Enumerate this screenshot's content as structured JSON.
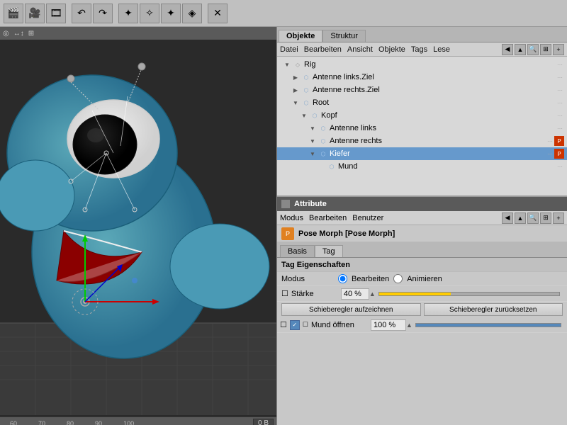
{
  "toolbar": {
    "icons": [
      "■",
      "▶",
      "⬛",
      "↶",
      "↷",
      "✦",
      "✧",
      "✦",
      "◈",
      "✕"
    ]
  },
  "viewport": {
    "top_bar_items": [
      "◎",
      "↔↕",
      "⊞"
    ],
    "ruler_marks": [
      "60",
      "70",
      "80",
      "90",
      "100"
    ],
    "ruler_info": "0 B"
  },
  "object_panel": {
    "tabs": [
      "Objekte",
      "Struktur"
    ],
    "menubar_items": [
      "Datei",
      "Bearbeiten",
      "Ansicht",
      "Objekte",
      "Tags",
      "Lese"
    ],
    "tree_items": [
      {
        "label": "Rig",
        "depth": 1,
        "expanded": true,
        "has_tag": false
      },
      {
        "label": "Antenne links.Ziel",
        "depth": 2,
        "expanded": false,
        "has_tag": false
      },
      {
        "label": "Antenne rechts.Ziel",
        "depth": 2,
        "expanded": false,
        "has_tag": false
      },
      {
        "label": "Root",
        "depth": 2,
        "expanded": true,
        "has_tag": false
      },
      {
        "label": "Kopf",
        "depth": 3,
        "expanded": true,
        "has_tag": false
      },
      {
        "label": "Antenne links",
        "depth": 4,
        "expanded": true,
        "has_tag": false
      },
      {
        "label": "Antenne rechts",
        "depth": 4,
        "expanded": true,
        "has_tag": true
      },
      {
        "label": "Kiefer",
        "depth": 4,
        "expanded": true,
        "has_tag": true
      },
      {
        "label": "Mund",
        "depth": 5,
        "expanded": false,
        "has_tag": false
      }
    ]
  },
  "attribute_panel": {
    "header_label": "Attribute",
    "menubar_items": [
      "Modus",
      "Bearbeiten",
      "Benutzer"
    ],
    "title": "Pose Morph [Pose Morph]",
    "tabs": [
      "Basis",
      "Tag"
    ],
    "active_tab": "Tag",
    "section_header": "Tag Eigenschaften",
    "modus_label": "Modus",
    "modus_options": [
      "Bearbeiten",
      "Animieren"
    ],
    "modus_selected": "Bearbeiten",
    "staerke_label": "Stärke",
    "staerke_value": "40 %",
    "btn_aufzeichnen": "Schieberegler aufzeichnen",
    "btn_zuruecksetzen": "Schieberegler zurücksetzen",
    "morph_label": "Mund öffnen",
    "morph_value": "100 %"
  }
}
